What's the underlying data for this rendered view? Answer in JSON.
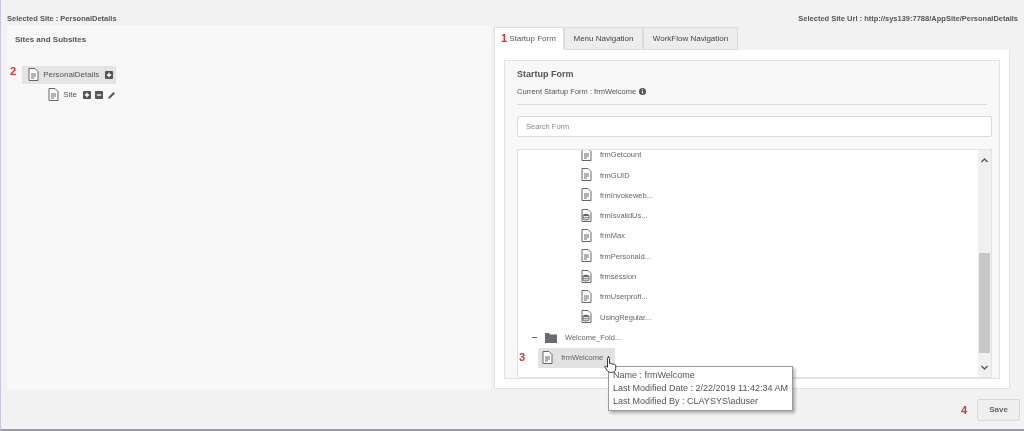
{
  "header": {
    "selected_site": "Selected Site : PersonalDetails",
    "selected_site_url": "Selected Site Url : http://sys139:7788/AppSite/PersonalDetails"
  },
  "sites_panel": {
    "title": "Sites and Subsites",
    "annotation": "2",
    "tree": [
      {
        "label": "PersonalDetails",
        "selected": true,
        "children": [
          {
            "label": "Site",
            "selected": false
          }
        ]
      }
    ]
  },
  "tabs": [
    {
      "label": "Startup Form",
      "selected": true,
      "annotation": "1"
    },
    {
      "label": "Menu Navigation",
      "selected": false
    },
    {
      "label": "WorkFlow Navigation",
      "selected": false
    }
  ],
  "startup_form": {
    "title": "Startup Form",
    "current": "Current Startup Form : frmWelcome",
    "search": {
      "placeholder": "Search Form"
    },
    "items": [
      {
        "label": "frmGetcount",
        "kind": "form"
      },
      {
        "label": "frmGUID",
        "kind": "form"
      },
      {
        "label": "frmInvokeweb...",
        "kind": "form"
      },
      {
        "label": "frmIsvalidUs...",
        "kind": "data"
      },
      {
        "label": "frmMax",
        "kind": "form"
      },
      {
        "label": "frmPersonald...",
        "kind": "form"
      },
      {
        "label": "frmsession",
        "kind": "data"
      },
      {
        "label": "frmUserprofi...",
        "kind": "form"
      },
      {
        "label": "UsingRegular...",
        "kind": "data"
      },
      {
        "label": "Welcome_Fold...",
        "kind": "folder",
        "expanded": true,
        "children": [
          {
            "label": "frmWelcome",
            "kind": "form",
            "selected": true,
            "annotation": "3"
          }
        ]
      }
    ]
  },
  "tooltip": {
    "lines": [
      "Name : frmWelcome",
      "Last Modified Date : 2/22/2019 11:42:34 AM",
      "Last Modified By : CLAYSYS\\aduser"
    ]
  },
  "save": {
    "label": "Save",
    "annotation": "4"
  }
}
